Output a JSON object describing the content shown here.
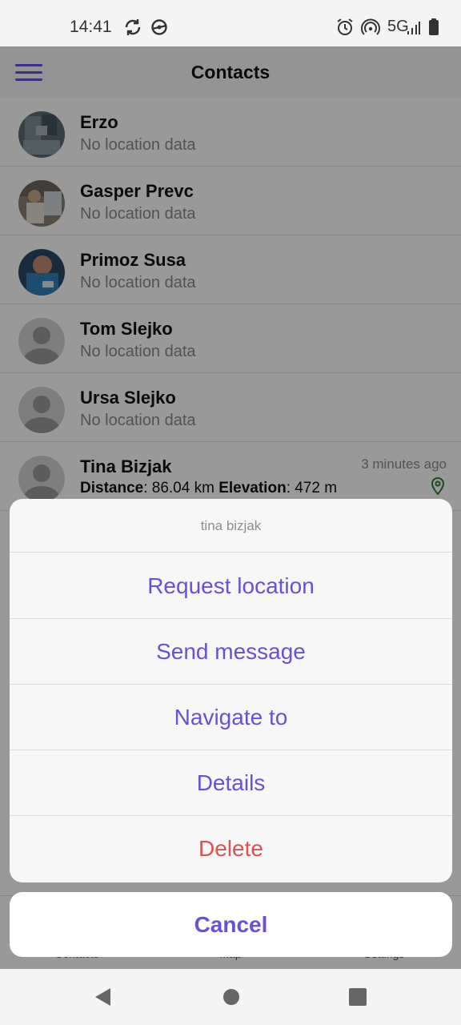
{
  "status_bar": {
    "time": "14:41",
    "network": "5G",
    "icons": [
      "sync-icon",
      "vpn-icon",
      "alarm-icon",
      "hotspot-icon",
      "signal-icon",
      "battery-icon"
    ]
  },
  "app_bar": {
    "title": "Contacts",
    "menu_icon": "hamburger-menu-icon"
  },
  "contacts": [
    {
      "name": "Erzo",
      "status": "No location data",
      "avatar": "photo"
    },
    {
      "name": "Gasper Prevc",
      "status": "No location data",
      "avatar": "photo"
    },
    {
      "name": "Primoz Susa",
      "status": "No location data",
      "avatar": "photo"
    },
    {
      "name": "Tom Slejko",
      "status": "No location data",
      "avatar": "placeholder"
    },
    {
      "name": "Ursa Slejko",
      "status": "No location data",
      "avatar": "placeholder"
    },
    {
      "name": "Tina Bizjak",
      "avatar": "placeholder",
      "time": "3 minutes ago",
      "distance_label": "Distance",
      "distance_value": ": 86.04 km ",
      "elevation_label": "Elevation",
      "elevation_value": ": 472 m",
      "location_icon": "map-pin-icon"
    }
  ],
  "action_sheet": {
    "title": "tina bizjak",
    "items": [
      "Request location",
      "Send message",
      "Navigate to",
      "Details",
      "Delete"
    ],
    "cancel": "Cancel"
  },
  "bottom_nav": {
    "tabs": [
      "Contacts",
      "Map",
      "Settings"
    ]
  },
  "colors": {
    "accent": "#6a4fd8",
    "danger": "#d9534f",
    "pin": "#2e7d32"
  },
  "system_nav": {
    "icons": [
      "back-icon",
      "home-icon",
      "recents-icon"
    ]
  }
}
